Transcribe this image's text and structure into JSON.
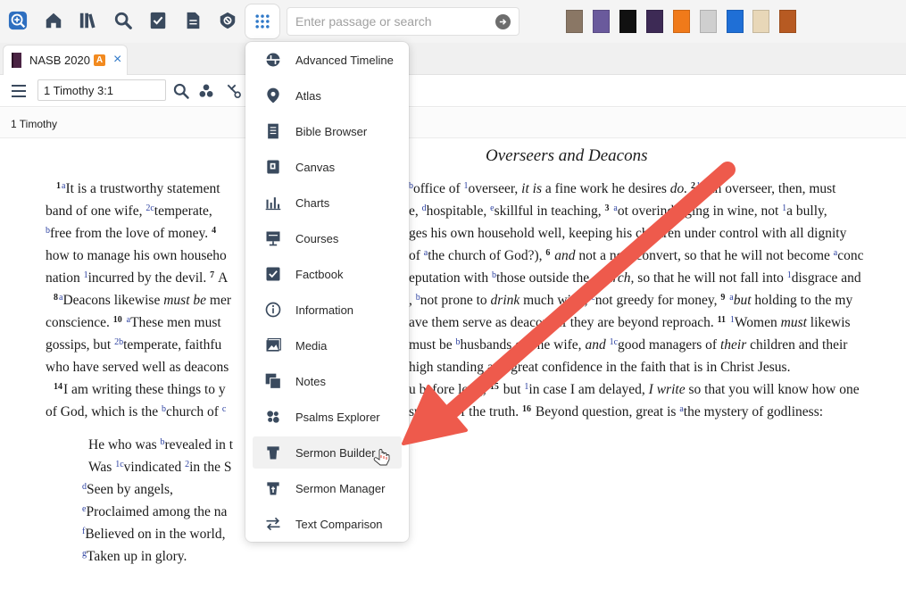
{
  "toolbar": {
    "search_placeholder": "Enter passage or search",
    "icons": [
      "logos-home-icon",
      "home-icon",
      "library-icon",
      "search-icon",
      "checklist-icon",
      "document-icon",
      "shield-icon",
      "tools-grid-icon"
    ]
  },
  "tab": {
    "label": "NASB 2020",
    "badge": "A",
    "close": "×"
  },
  "reference": {
    "value": "1 Timothy 3:1"
  },
  "section_label": "1 Timothy",
  "menu": {
    "items": [
      {
        "label": "Advanced Timeline",
        "icon": "timeline-icon"
      },
      {
        "label": "Atlas",
        "icon": "map-pin-icon"
      },
      {
        "label": "Bible Browser",
        "icon": "list-doc-icon"
      },
      {
        "label": "Canvas",
        "icon": "canvas-icon"
      },
      {
        "label": "Charts",
        "icon": "bar-chart-icon"
      },
      {
        "label": "Courses",
        "icon": "presentation-icon"
      },
      {
        "label": "Factbook",
        "icon": "factbook-icon"
      },
      {
        "label": "Information",
        "icon": "info-icon"
      },
      {
        "label": "Media",
        "icon": "image-icon"
      },
      {
        "label": "Notes",
        "icon": "notes-icon"
      },
      {
        "label": "Psalms Explorer",
        "icon": "dots-cluster-icon"
      },
      {
        "label": "Sermon Builder",
        "icon": "pulpit-icon"
      },
      {
        "label": "Sermon Manager",
        "icon": "cross-pulpit-icon"
      },
      {
        "label": "Text Comparison",
        "icon": "swap-arrows-icon"
      }
    ]
  },
  "reading": {
    "heading": "Overseers and Deacons",
    "l1a": "It is a trustworthy statement",
    "l1b": "office of ",
    "l1c": "overseer, ",
    "l1d": "it is",
    "l1e": " a fine work he desires ",
    "l1f": "do.",
    "l1g": "An overseer, then, must",
    "l2a": "band of one wife, ",
    "l2b": "temperate,",
    "l2c": "e, ",
    "l2d": "hospitable, ",
    "l2e": "skillful in teaching, ",
    "l2f": "ot overindulging in wine, not ",
    "l2g": "a bully,",
    "l3a": "free from the love of money.",
    "l3b": "ges his own household well, keeping his children under control with all dignity",
    "l4a": "how to manage his own househo",
    "l4b": "of ",
    "l4c": "the church of God?), ",
    "l4d": "and",
    "l4e": " not a new convert, so that he will not become ",
    "l4f": "conc",
    "l5a": "nation ",
    "l5b": "incurred by the devil.",
    "l5c": " A",
    "l5d": "eputation with ",
    "l5e": "those outside the ",
    "l5f": "church,",
    "l5g": " so that he will not fall into ",
    "l5h": "disgrace and",
    "l6a": "Deacons likewise ",
    "l6b": "must be",
    "l6c": " mer",
    "l6d": "not prone to ",
    "l6e": "drink",
    "l6f": " much wine, ",
    "l6g": "not greedy for money, ",
    "l6h": "but",
    "l6i": " holding to the my",
    "l7a": "conscience. ",
    "l7b": "These men must",
    "l7c": "ave them serve as deacons if they are beyond reproach. ",
    "l7d": "Women ",
    "l7e": "must",
    "l7f": " likewis",
    "l8a": "gossips, but ",
    "l8b": "temperate, faithfu",
    "l8c": "must be ",
    "l8d": "husbands of one wife, ",
    "l8e": "and",
    "l8f": "good managers of ",
    "l8g": "their",
    "l8h": " children and their",
    "l9a": "who have served well as deacons",
    "l9b": "high standing and great confidence in the faith that is in Christ Jesus.",
    "l10a": "I am writing these things to y",
    "l10b": "u before long; ",
    "l10c": " but ",
    "l10d": "in case I am delayed, ",
    "l10e": "I write",
    "l10f": " so that you will know how one",
    "l11a": "of God, which is the ",
    "l11b": "church of ",
    "l11c": "support of the truth. ",
    "l11d": " Beyond question, great is ",
    "l11e": "the mystery of godliness:",
    "p1": "He who was ",
    "p1b": "revealed in t",
    "p2": "Was ",
    "p2b": "vindicated ",
    "p2c": "in the S",
    "p3": "Seen by angels,",
    "p4": "Proclaimed among the na",
    "p5": "Believed on in the world,",
    "p6": "Taken up in glory."
  },
  "colors": {
    "accent": "#2e78c8",
    "arrow": "#ee5a4c",
    "badge": "#f28a1f",
    "footnote": "#2a3fa0"
  }
}
